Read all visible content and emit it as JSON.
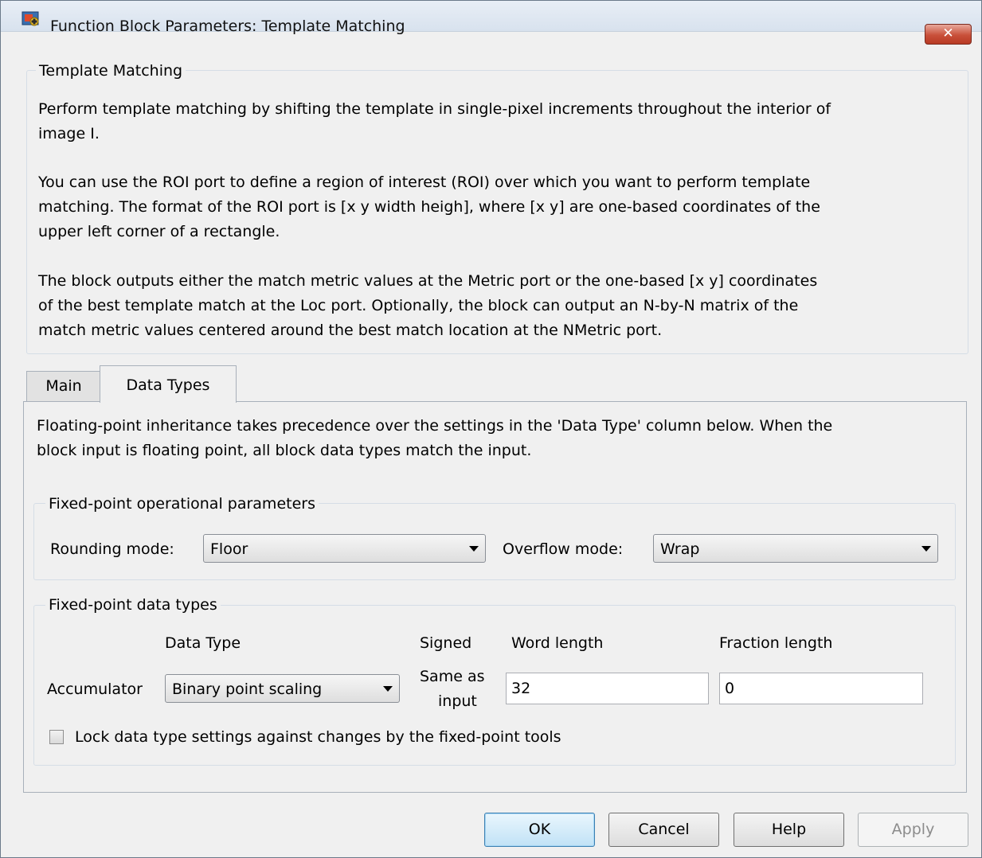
{
  "window": {
    "title": "Function Block Parameters: Template Matching",
    "close_label": "✕"
  },
  "description": {
    "group_label": "Template Matching",
    "paragraphs": [
      "Perform template matching by shifting the template in single-pixel increments throughout the interior of image I.",
      "You can use the ROI port to define a region of interest (ROI) over which you want to perform template matching. The format of the ROI port is [x y width heigh], where [x y] are one-based coordinates of the upper left corner of a rectangle.",
      "The block outputs either the match metric values at the Metric port or the one-based [x y] coordinates of the best template match at the Loc port.  Optionally, the block can output an N-by-N matrix of the match metric values centered around the best match location at the NMetric port."
    ],
    "lines": [
      [
        "Perform template matching by shifting the template in single-pixel increments throughout the interior of",
        "image I."
      ],
      [
        "You can use the ROI port to define a region of interest (ROI) over which you want to perform template",
        "matching. The format of the ROI port is [x y width heigh], where [x y] are one-based coordinates of the",
        "upper left corner of a rectangle."
      ],
      [
        "The block outputs either the match metric values at the Metric port or the one-based [x y] coordinates",
        "of the best template match at the Loc port.  Optionally, the block can output an N-by-N matrix of the",
        "match metric values centered around the best match location at the NMetric port."
      ]
    ]
  },
  "tabs": [
    {
      "label": "Main",
      "active": false
    },
    {
      "label": "Data Types",
      "active": true
    }
  ],
  "data_types": {
    "intro_lines": [
      "Floating-point inheritance takes precedence over the settings in the 'Data Type' column below. When the",
      "block input is floating point, all block data types match the input."
    ],
    "operational": {
      "group_label": "Fixed-point operational parameters",
      "rounding_label": "Rounding mode:",
      "rounding_value": "Floor",
      "overflow_label": "Overflow mode:",
      "overflow_value": "Wrap"
    },
    "fixed_types": {
      "group_label": "Fixed-point data types",
      "headers": {
        "data_type": "Data Type",
        "signed": "Signed",
        "word_length": "Word length",
        "fraction_length": "Fraction length"
      },
      "accumulator": {
        "label": "Accumulator",
        "data_type": "Binary point scaling",
        "signed_line1": "Same as",
        "signed_line2": "input",
        "word_length": "32",
        "fraction_length": "0"
      },
      "lock_label": "Lock data type settings against changes by the fixed-point tools",
      "lock_checked": false
    }
  },
  "buttons": {
    "ok": "OK",
    "cancel": "Cancel",
    "help": "Help",
    "apply": "Apply"
  },
  "colors": {
    "dialog_bg": "#f0f0f0",
    "close_button": "#c9503a",
    "ok_button_border": "#3c7fb1"
  }
}
